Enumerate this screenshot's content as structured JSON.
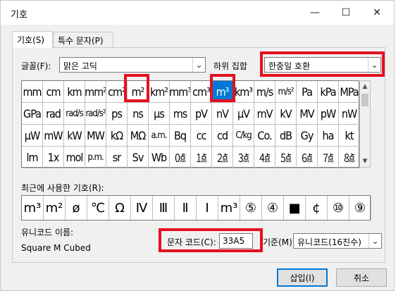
{
  "window": {
    "title": "기호"
  },
  "titlebar": {
    "minimize": "—",
    "maximize": "☐",
    "close": "✕"
  },
  "tabs": [
    {
      "label": "기호(S)"
    },
    {
      "label": "특수 문자(P)"
    }
  ],
  "font": {
    "label": "글꼴(F):",
    "value": "맑은 고딕"
  },
  "subset": {
    "label": "하위 집합",
    "value": "한중일 호환"
  },
  "grid": {
    "rows": [
      [
        "mm",
        "cm",
        "km",
        "mm²",
        "cm²",
        "m²",
        "km²",
        "mm³",
        "cm³",
        "m³",
        "km³",
        "m/s",
        "m/s²",
        "Pa",
        "kPa",
        "MPa"
      ],
      [
        "GPa",
        "rad",
        "rad/s",
        "rad/s²",
        "ps",
        "ns",
        "μs",
        "ms",
        "pV",
        "nV",
        "μV",
        "mV",
        "kV",
        "MV",
        "pW",
        "nW"
      ],
      [
        "μW",
        "mW",
        "kW",
        "MW",
        "kΩ",
        "MΩ",
        "a.m.",
        "Bq",
        "cc",
        "cd",
        "C/kg",
        "Co.",
        "dB",
        "Gy",
        "ha",
        "kt"
      ],
      [
        "lm",
        "1x",
        "mol",
        "p.m.",
        "sr",
        "Sv",
        "Wb",
        "㍘",
        "㍙",
        "㍚",
        "㍛",
        "㍜",
        "㍝",
        "㍞",
        "㍟",
        "㍠"
      ]
    ],
    "selected_symbol": "m³"
  },
  "recent": {
    "label": "최근에 사용한 기호(R):",
    "symbols": [
      "m³",
      "m²",
      "ø",
      "℃",
      "Ω",
      "Ⅳ",
      "Ⅲ",
      "Ⅱ",
      "Ⅰ",
      "m³",
      "⑤",
      "④",
      "■",
      "¢",
      "⑩",
      "⑨"
    ]
  },
  "unicode_name": {
    "label": "유니코드 이름:",
    "value": "Square M Cubed"
  },
  "char_code": {
    "label": "문자 코드(C):",
    "value": "33A5"
  },
  "from": {
    "label": "기준(M):",
    "value": "유니코드(16진수)"
  },
  "buttons": {
    "insert": "삽입(I)",
    "cancel": "취소"
  },
  "colors": {
    "accent": "#0078d7",
    "highlight_box": "#e5101f"
  }
}
